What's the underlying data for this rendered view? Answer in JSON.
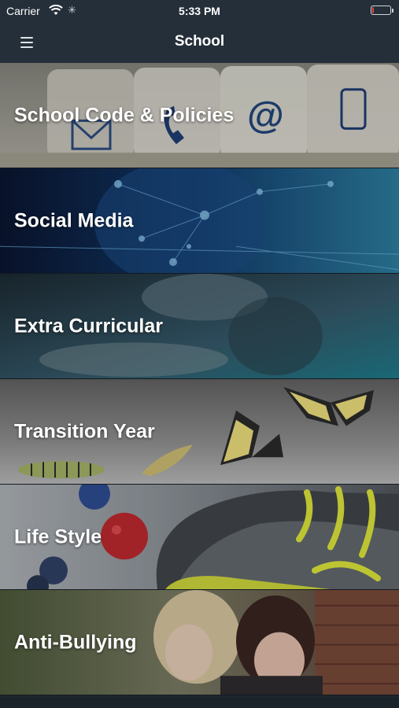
{
  "status_bar": {
    "carrier": "Carrier",
    "time": "5:33 PM",
    "battery_level": 0.1,
    "icons": [
      "wifi-icon",
      "activity-spinner-icon",
      "battery-low-icon"
    ]
  },
  "nav": {
    "title": "School",
    "menu_icon": "hamburger-menu-icon"
  },
  "categories": [
    {
      "label": "School Code & Policies"
    },
    {
      "label": "Social Media"
    },
    {
      "label": "Extra Curricular"
    },
    {
      "label": "Transition Year"
    },
    {
      "label": "Life Style"
    },
    {
      "label": "Anti-Bullying"
    }
  ],
  "colors": {
    "bar_bg": "#252f39",
    "text": "#ffffff",
    "battery_low": "#e5443f"
  }
}
